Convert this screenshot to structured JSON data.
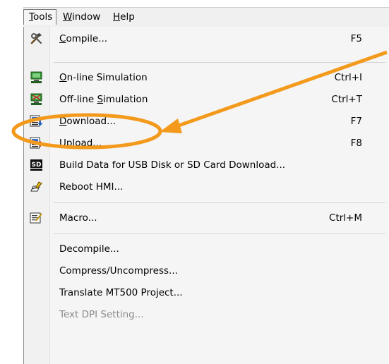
{
  "menubar": {
    "tools": {
      "u": "T",
      "rest": "ools"
    },
    "window": {
      "u": "W",
      "rest": "indow"
    },
    "help": {
      "u": "H",
      "rest": "elp"
    }
  },
  "menu": {
    "compile": {
      "u": "C",
      "rest": "ompile...",
      "shortcut": "F5",
      "icon": "hammer-wrench-icon"
    },
    "online": {
      "u": "O",
      "rest": "n-line Simulation",
      "shortcut": "Ctrl+I",
      "icon": "online-simulation-icon"
    },
    "offline": {
      "pre": "Off-line ",
      "u": "S",
      "rest": "imulation",
      "shortcut": "Ctrl+T",
      "icon": "offline-simulation-icon"
    },
    "download": {
      "u": "D",
      "rest": "ownload...",
      "shortcut": "F7",
      "icon": "download-icon"
    },
    "upload": {
      "u": "U",
      "rest": "pload...",
      "shortcut": "F8",
      "icon": "upload-icon"
    },
    "builddata": {
      "label": "Build Data for USB Disk or SD Card Download...",
      "icon": "sd-card-icon",
      "icon_text": "SD"
    },
    "reboot": {
      "label": "Reboot HMI...",
      "icon": "reboot-hmi-icon"
    },
    "macro": {
      "label": "Macro...",
      "shortcut": "Ctrl+M",
      "icon": "macro-icon"
    },
    "decompile": {
      "label": "Decompile..."
    },
    "compress": {
      "label": "Compress/Uncompress..."
    },
    "translate": {
      "label": "Translate MT500 Project..."
    },
    "textdpi": {
      "label": "Text DPI Setting...",
      "disabled": true
    }
  },
  "colors": {
    "highlight_orange": "#f39a1d"
  }
}
